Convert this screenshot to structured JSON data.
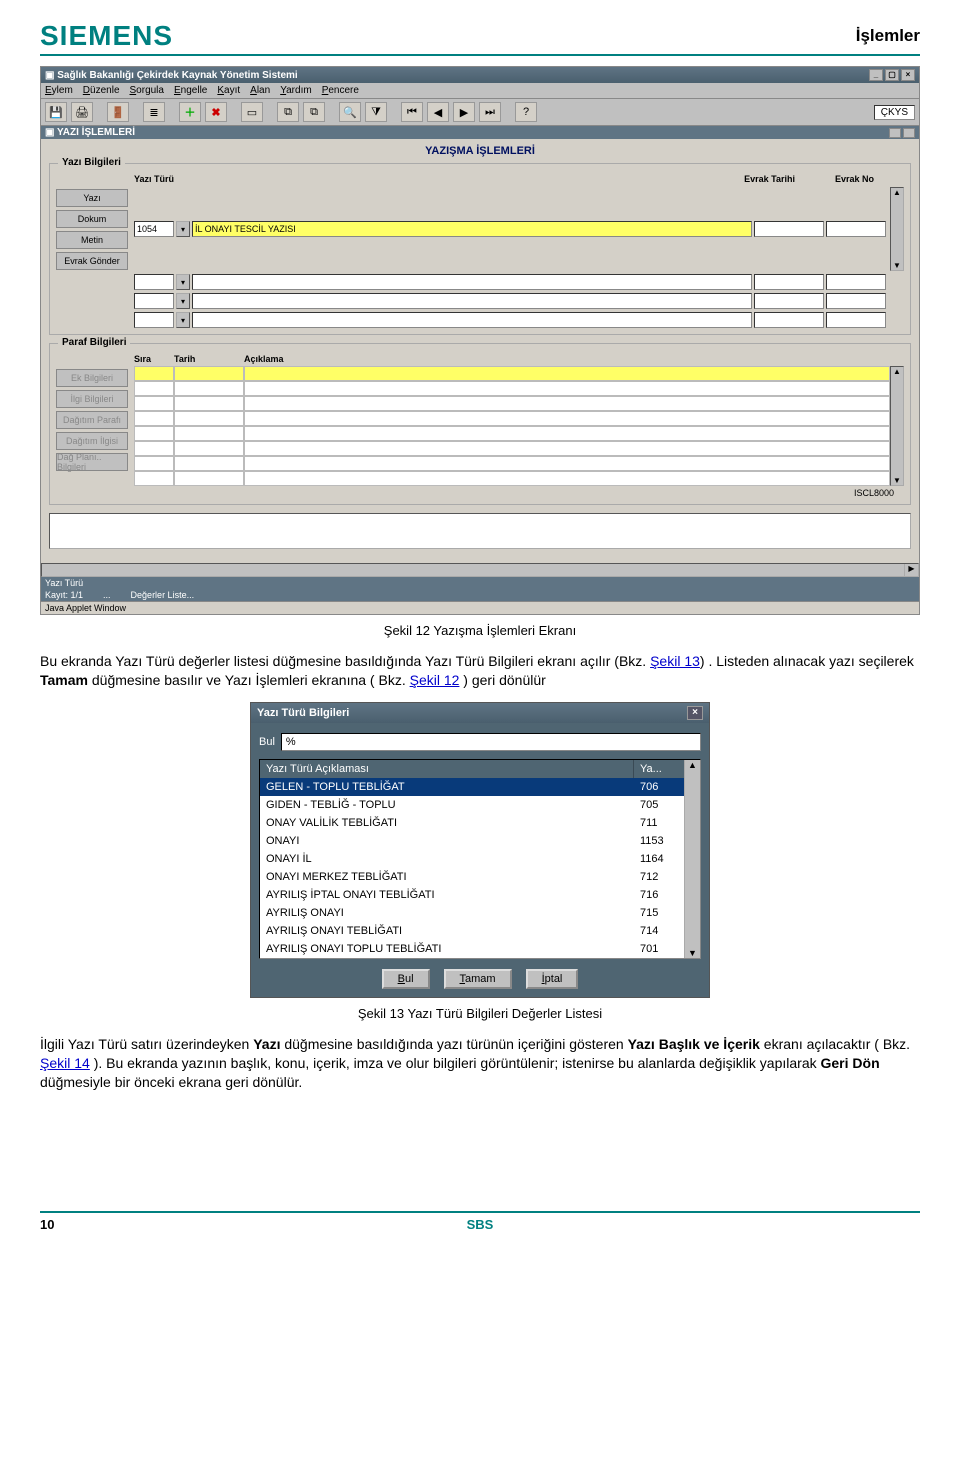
{
  "header": {
    "brand": "SIEMENS",
    "section": "İşlemler"
  },
  "app": {
    "title": "Sağlık Bakanlığı Çekirdek Kaynak Yönetim Sistemi",
    "menu": [
      "Eylem",
      "Düzenle",
      "Sorgula",
      "Engelle",
      "Kayıt",
      "Alan",
      "Yardım",
      "Pencere"
    ],
    "ckys": "ÇKYS",
    "sub_title": "YAZI İŞLEMLERİ",
    "screen_title": "YAZIŞMA İŞLEMLERİ",
    "grp1_label": "Yazı Bilgileri",
    "grp1": {
      "header": "Yazı Türü",
      "code": "1054",
      "desc": "İL ONAYI TESCİL YAZISI",
      "evrak_tarihi": "Evrak Tarihi",
      "evrak_no": "Evrak No",
      "btns": [
        "Yazı",
        "Dokum",
        "Metin",
        "Evrak Gönder"
      ]
    },
    "grp2_label": "Paraf Bilgileri",
    "grp2": {
      "heads": [
        "Sıra",
        "Tarih",
        "Açıklama"
      ],
      "btns": [
        "Ek Bilgileri",
        "İlgi Bilgileri",
        "Dağıtım Parafı",
        "Dağıtım İlgisi",
        "Dağ Planı.. Bilgileri"
      ]
    },
    "iscl": "ISCL8000",
    "status_yazi": "Yazı Türü",
    "status_kayit": "Kayıt: 1/1",
    "status_dots": "...",
    "status_deger": "Değerler Liste...",
    "java": "Java Applet Window"
  },
  "caption1": "Şekil 12 Yazışma İşlemleri Ekranı",
  "para1_a": "Bu ekranda Yazı Türü değerler listesi düğmesine basıldığında Yazı Türü Bilgileri ekranı açılır (Bkz. ",
  "para1_link1": "Şekil 13",
  "para1_b": ") . Listeden alınacak yazı seçilerek ",
  "para1_bold1": "Tamam",
  "para1_c": " düğmesine basılır ve Yazı İşlemleri ekranına ( Bkz. ",
  "para1_link2": "Şekil 12",
  "para1_d": " ) geri dönülür",
  "dialog": {
    "title": "Yazı Türü Bilgileri",
    "bul_label": "Bul",
    "bul_value": "%",
    "col1": "Yazı Türü Açıklaması",
    "col2": "Ya...",
    "rows": [
      {
        "t": "GELEN - TOPLU TEBLİĞAT",
        "n": "706",
        "sel": true
      },
      {
        "t": "GIDEN - TEBLİĞ - TOPLU",
        "n": "705"
      },
      {
        "t": "ONAY VALİLİK TEBLİĞATI",
        "n": "711"
      },
      {
        "t": "ONAYI",
        "n": "1153"
      },
      {
        "t": "ONAYI İL",
        "n": "1164"
      },
      {
        "t": "ONAYI MERKEZ TEBLİĞATI",
        "n": "712"
      },
      {
        "t": "AYRILIŞ İPTAL ONAYI TEBLİĞATI",
        "n": "716"
      },
      {
        "t": "AYRILIŞ ONAYI",
        "n": "715"
      },
      {
        "t": "AYRILIŞ ONAYI TEBLİĞATI",
        "n": "714"
      },
      {
        "t": "AYRILIŞ ONAYI TOPLU TEBLİĞATI",
        "n": "701"
      }
    ],
    "btn_bul": "Bul",
    "btn_tamam": "Tamam",
    "btn_iptal": "İptal"
  },
  "caption2": "Şekil 13 Yazı Türü Bilgileri Değerler Listesi",
  "para2_a": "İlgili Yazı Türü satırı üzerindeyken ",
  "para2_bold1": "Yazı",
  "para2_b": " düğmesine basıldığında yazı türünün içeriğini gösteren ",
  "para2_bold2": "Yazı Başlık ve İçerik",
  "para2_c": " ekranı açılacaktır ( Bkz. ",
  "para2_link": "Şekil 14",
  "para2_d": " ). Bu ekranda yazının başlık, konu, içerik, imza ve olur bilgileri görüntülenir; istenirse bu alanlarda değişiklik yapılarak ",
  "para2_bold3": "Geri Dön",
  "para2_e": " düğmesiyle bir önceki ekrana geri dönülür.",
  "footer": {
    "page": "10",
    "sbs": "SBS"
  }
}
